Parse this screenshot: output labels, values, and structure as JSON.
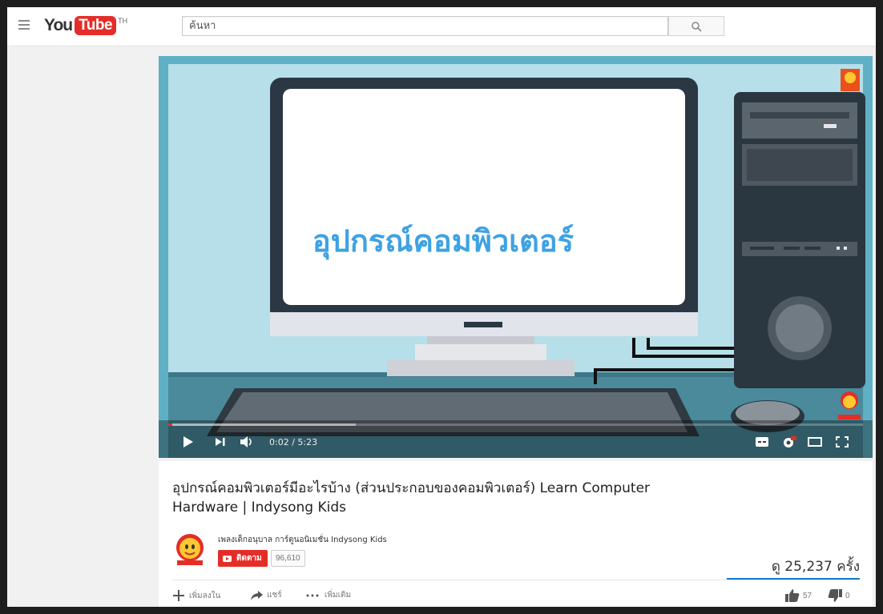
{
  "header": {
    "logo_you": "You",
    "logo_tube": "Tube",
    "logo_country": "TH",
    "search_placeholder": "ค้นหา"
  },
  "player": {
    "slide_title": "อุปกรณ์คอมพิวเตอร์",
    "time": "0:02 / 5:23",
    "progress_fraction": 0.006,
    "buffered_fraction": 0.27,
    "hd_badge": "HD"
  },
  "video": {
    "title": "อุปกรณ์คอมพิวเตอร์มีอะไรบ้าง (ส่วนประกอบของคอมพิวเตอร์) Learn Computer Hardware | Indysong Kids",
    "channel_name": "เพลงเด็กอนุบาล การ์ตูนอนิเมชั่น Indysong Kids",
    "subscribe_label": "ติดตาม",
    "subscriber_count": "96,610",
    "views": "ดู 25,237 ครั้ง",
    "likes": "57",
    "dislikes": "0",
    "like_fraction": 1.0
  },
  "actions": {
    "add_to": "เพิ่มลงใน",
    "share": "แชร์",
    "more": "เพิ่มเติม"
  },
  "colors": {
    "brand_red": "#e52d27",
    "slide_text": "#3ea2e3",
    "like_bar": "#167ac6"
  },
  "icons": [
    "menu-icon",
    "search-icon",
    "play-icon",
    "next-icon",
    "volume-icon",
    "captions-icon",
    "settings-icon",
    "theater-icon",
    "fullscreen-icon",
    "add-icon",
    "share-icon",
    "more-icon",
    "like-icon",
    "dislike-icon"
  ]
}
